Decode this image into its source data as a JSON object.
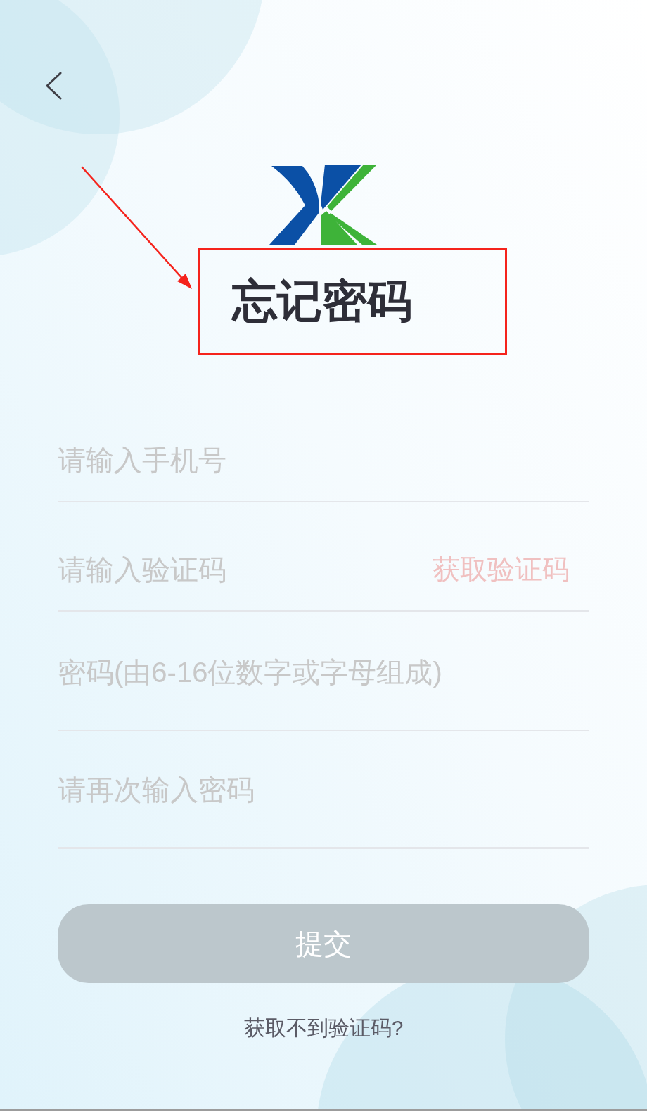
{
  "header": {
    "title": "忘记密码"
  },
  "form": {
    "fields": [
      {
        "placeholder": "请输入手机号"
      },
      {
        "placeholder": "请输入验证码",
        "action": "获取验证码"
      },
      {
        "placeholder": "密码(由6-16位数字或字母组成)"
      },
      {
        "placeholder": "请再次输入密码"
      }
    ],
    "submit": {
      "label": "提交",
      "disabled": true
    },
    "help_link": "获取不到验证码?"
  }
}
